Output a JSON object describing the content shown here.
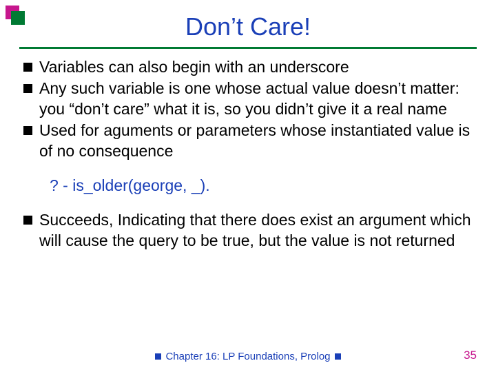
{
  "title": "Don’t Care!",
  "bullets": {
    "b0": "Variables can also begin with an underscore",
    "b1": "Any such variable is one whose actual value doesn’t matter: you “don’t care” what it is, so you didn’t give it a real name",
    "b2": "Used for aguments or parameters whose instantiated value is of no consequence",
    "b3": "Succeeds, Indicating that there does exist an argument which will cause the query to be true, but the value is not returned"
  },
  "code": "? - is_older(george, _).",
  "footer": "Chapter 16: LP Foundations, Prolog",
  "page": "35",
  "colors": {
    "title": "#1a3fb7",
    "rule": "#007a33",
    "accent_magenta": "#c6168d",
    "accent_green": "#007a33",
    "footer": "#1a3fb7",
    "page_num": "#c6168d"
  }
}
